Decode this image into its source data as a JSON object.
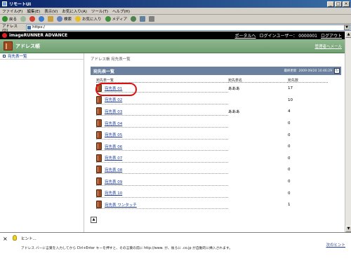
{
  "window": {
    "title": "リモートUI",
    "controls": [
      "_",
      "□",
      "×"
    ]
  },
  "menubar": [
    "ファイル(F)",
    "編集(E)",
    "表示(V)",
    "お気に入り(A)",
    "ツール(T)",
    "ヘルプ(H)"
  ],
  "toolbar": {
    "back": "戻る",
    "search": "検索",
    "favorites": "お気に入り",
    "media": "メディア"
  },
  "address": {
    "label": "アドレス(D)",
    "value": "https:/"
  },
  "brand": {
    "name": "imageRUNNER ADVANCE",
    "portal_link": "ポータルへ",
    "login_user": "ログインユーザー： 0000001",
    "logout": "ログアウト"
  },
  "header": {
    "title": "アドレス帳",
    "admin_mail": "管理者へメール"
  },
  "leftnav": {
    "items": [
      {
        "label": "宛先表一覧"
      }
    ]
  },
  "breadcrumb": "アドレス帳 宛先表一覧",
  "section": {
    "title": "宛先表一覧",
    "updated_label": "最終更新",
    "updated_value": "2009 09/20 10:46:29"
  },
  "table": {
    "headers": [
      "宛先表一覧",
      "宛先表名",
      "宛先数"
    ],
    "rows": [
      {
        "name": "宛先表 01",
        "label": "あああ",
        "count": "17"
      },
      {
        "name": "宛先表 02",
        "label": "",
        "count": "10"
      },
      {
        "name": "宛先表 03",
        "label": "あああ",
        "count": "4"
      },
      {
        "name": "宛先表 04",
        "label": "",
        "count": "0"
      },
      {
        "name": "宛先表 05",
        "label": "",
        "count": "0"
      },
      {
        "name": "宛先表 06",
        "label": "",
        "count": "0"
      },
      {
        "name": "宛先表 07",
        "label": "",
        "count": "0"
      },
      {
        "name": "宛先表 08",
        "label": "",
        "count": "0"
      },
      {
        "name": "宛先表 09",
        "label": "",
        "count": "0"
      },
      {
        "name": "宛先表 10",
        "label": "",
        "count": "0"
      },
      {
        "name": "宛先表 ワンタッチ",
        "label": "",
        "count": "1"
      }
    ]
  },
  "hint": {
    "title": "ヒント...",
    "body": "アドレス バーに言葉を入力してから Ctrl+Enter キーを押すと、その言葉の前に http://www. が、後ろに .co.jp が自動的に挿入されます。",
    "next": "次のヒント"
  }
}
